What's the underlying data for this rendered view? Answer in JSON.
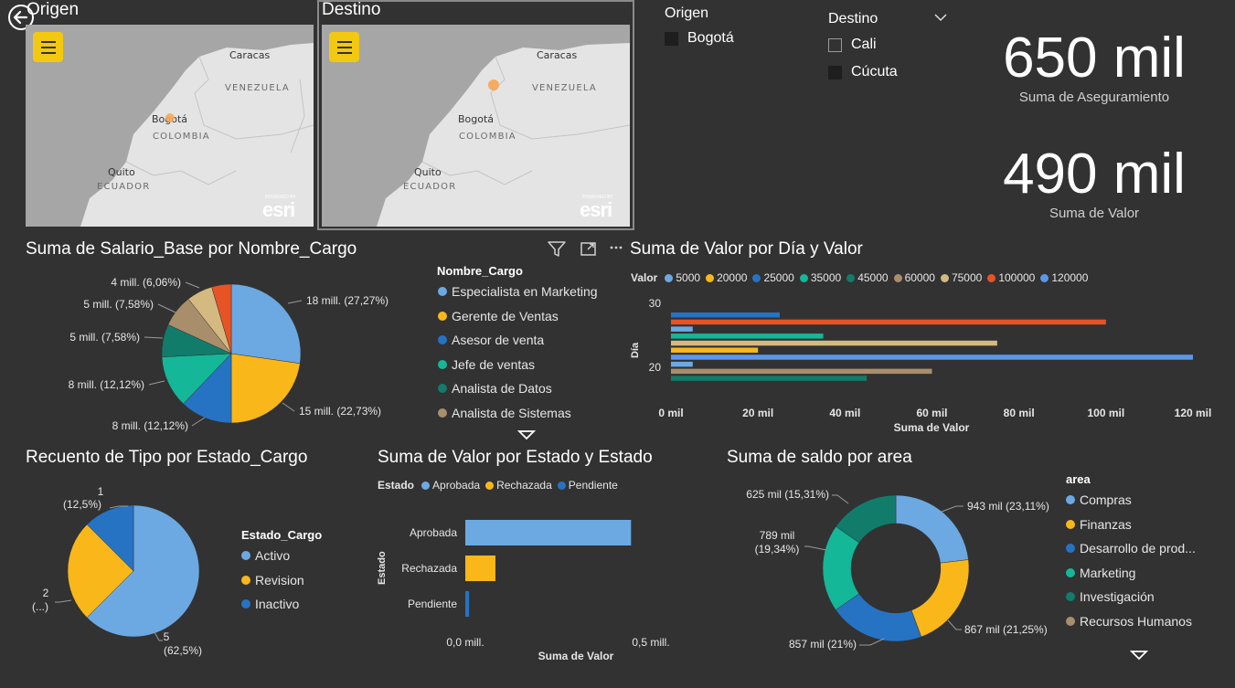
{
  "maps": {
    "origen": {
      "title": "Origen",
      "cities": {
        "caracas": "Caracas",
        "bogota": "Bogotá",
        "quito": "Quito"
      },
      "countries": {
        "venezuela": "VENEZUELA",
        "colombia": "COLOMBIA",
        "ecuador": "ECUADOR"
      },
      "attribution": "esri",
      "powered": "POWERED BY"
    },
    "destino": {
      "title": "Destino",
      "cities": {
        "caracas": "Caracas",
        "bogota": "Bogotá",
        "quito": "Quito"
      },
      "countries": {
        "venezuela": "VENEZUELA",
        "colombia": "COLOMBIA",
        "ecuador": "ECUADOR"
      },
      "attribution": "esri",
      "powered": "POWERED BY"
    }
  },
  "slicers": {
    "origen": {
      "title": "Origen",
      "items": [
        {
          "label": "Bogotá",
          "checked": true
        }
      ]
    },
    "destino": {
      "title": "Destino",
      "items": [
        {
          "label": "Cali",
          "checked": false
        },
        {
          "label": "Cúcuta",
          "checked": true
        }
      ]
    }
  },
  "kpis": [
    {
      "value": "650 mil",
      "label": "Suma de Aseguramiento"
    },
    {
      "value": "490 mil",
      "label": "Suma de Valor"
    }
  ],
  "colors": {
    "c1": "#6CA9E2",
    "c2": "#F9B719",
    "c3": "#2673C4",
    "c4": "#14B797",
    "c5": "#127C6B",
    "c6": "#A98E6C",
    "c7": "#D4B980",
    "c8": "#E65325",
    "c9": "#5A98EA"
  },
  "chart_data": [
    {
      "type": "pie",
      "title": "Suma de Salario_Base por Nombre_Cargo",
      "legend_title": "Nombre_Cargo",
      "legend": [
        "Especialista en Marketing",
        "Gerente de Ventas",
        "Asesor de venta",
        "Jefe de ventas",
        "Analista de Datos",
        "Analista de Sistemas"
      ],
      "slices": [
        {
          "value": 27.27,
          "color": "#6CA9E2",
          "label": "18 mill. (27,27%)"
        },
        {
          "value": 22.73,
          "color": "#F9B719",
          "label": "15 mill. (22,73%)"
        },
        {
          "value": 12.12,
          "color": "#2673C4",
          "label": "8 mill. (12,12%)"
        },
        {
          "value": 12.12,
          "color": "#14B797",
          "label": "8 mill. (12,12%)"
        },
        {
          "value": 7.58,
          "color": "#127C6B",
          "label": "5 mill. (7,58%)"
        },
        {
          "value": 7.58,
          "color": "#A98E6C",
          "label": "5 mill. (7,58%)"
        },
        {
          "value": 6.06,
          "color": "#D4B980",
          "label": "4 mill. (6,06%)"
        },
        {
          "value": 4.54,
          "color": "#E65325",
          "label": ""
        }
      ]
    },
    {
      "type": "bar",
      "title": "Suma de Valor por Día y Valor",
      "legend_title": "Valor",
      "series": [
        {
          "name": "5000",
          "color": "#6CA9E2"
        },
        {
          "name": "20000",
          "color": "#F9B719"
        },
        {
          "name": "25000",
          "color": "#2673C4"
        },
        {
          "name": "35000",
          "color": "#14B797"
        },
        {
          "name": "45000",
          "color": "#127C6B"
        },
        {
          "name": "60000",
          "color": "#A98E6C"
        },
        {
          "name": "75000",
          "color": "#D4B980"
        },
        {
          "name": "100000",
          "color": "#E65325"
        },
        {
          "name": "120000",
          "color": "#5A98EA"
        }
      ],
      "bars": [
        {
          "value": 25000,
          "color": "#2673C4"
        },
        {
          "value": 100000,
          "color": "#E65325"
        },
        {
          "value": 5000,
          "color": "#6CA9E2"
        },
        {
          "value": 35000,
          "color": "#14B797"
        },
        {
          "value": 75000,
          "color": "#D4B980"
        },
        {
          "value": 20000,
          "color": "#F9B719"
        },
        {
          "value": 120000,
          "color": "#5A98EA"
        },
        {
          "value": 5000,
          "color": "#6CA9E2"
        },
        {
          "value": 60000,
          "color": "#A98E6C"
        },
        {
          "value": 45000,
          "color": "#127C6B"
        }
      ],
      "xticks": [
        "0 mil",
        "20 mil",
        "40 mil",
        "60 mil",
        "80 mil",
        "100 mil",
        "120 mil"
      ],
      "xlim": [
        0,
        120000
      ],
      "yticks": [
        "30",
        "20"
      ],
      "xlabel": "Suma de Valor",
      "ylabel": "Día"
    },
    {
      "type": "pie",
      "title": "Recuento de Tipo por Estado_Cargo",
      "legend_title": "Estado_Cargo",
      "legend": [
        "Activo",
        "Revision",
        "Inactivo"
      ],
      "slices": [
        {
          "value": 62.5,
          "color": "#6CA9E2",
          "label": "5",
          "sublabel": "(62,5%)"
        },
        {
          "value": 25,
          "color": "#F9B719",
          "label": "2",
          "sublabel": "(...)"
        },
        {
          "value": 12.5,
          "color": "#2673C4",
          "label": "1",
          "sublabel": "(12,5%)"
        }
      ]
    },
    {
      "type": "bar",
      "title": "Suma de Valor por Estado y Estado",
      "legend_title": "Estado",
      "series": [
        {
          "name": "Aprobada",
          "color": "#6CA9E2"
        },
        {
          "name": "Rechazada",
          "color": "#F9B719"
        },
        {
          "name": "Pendiente",
          "color": "#2673C4"
        }
      ],
      "categories": [
        "Aprobada",
        "Rechazada",
        "Pendiente"
      ],
      "values": [
        0.44,
        0.08,
        0.01
      ],
      "xlim": [
        0,
        0.5
      ],
      "xticks": [
        "0,0 mill.",
        "0,5 mill."
      ],
      "xlabel": "Suma de Valor",
      "ylabel": "Estado"
    },
    {
      "type": "pie",
      "title": "Suma de saldo por area",
      "legend_title": "area",
      "legend": [
        "Compras",
        "Finanzas",
        "Desarrollo de prod...",
        "Marketing",
        "Investigación",
        "Recursos Humanos"
      ],
      "slices": [
        {
          "value": 23.11,
          "color": "#6CA9E2",
          "label": "943 mil (23,11%)"
        },
        {
          "value": 21.25,
          "color": "#F9B719",
          "label": "867 mil (21,25%)"
        },
        {
          "value": 21.0,
          "color": "#2673C4",
          "label": "857 mil (21%)"
        },
        {
          "value": 19.34,
          "color": "#14B797",
          "label": "789 mil",
          "sublabel": "(19,34%)"
        },
        {
          "value": 15.31,
          "color": "#127C6B",
          "label": "625 mil (15,31%)"
        }
      ]
    }
  ]
}
